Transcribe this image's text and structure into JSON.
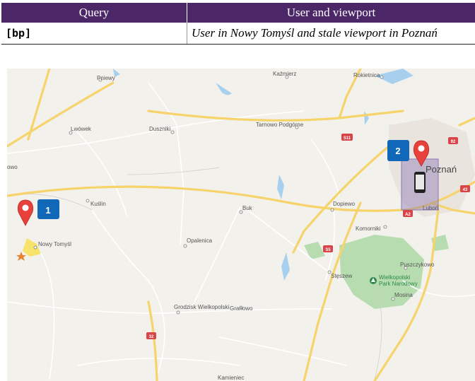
{
  "table": {
    "headers": [
      "Query",
      "User and viewport"
    ],
    "row": {
      "query": "[bp]",
      "description": "User in Nowy Tomyśl and stale viewport in Poznań"
    }
  },
  "map": {
    "places": [
      "Pniewy",
      "Kaźmierz",
      "Rokietnica",
      "Lwówek",
      "Duszniki",
      "Tarnowo Podgórne",
      "Kuślin",
      "Buk",
      "Dopiewo",
      "Nowy Tomyśl",
      "Opalenica",
      "Komorniki",
      "Stęszew",
      "Puszczykowo",
      "Mosina",
      "Grodzisk Wielkopolski",
      "Granowo",
      "Kamieniec",
      "Luboń",
      "Poznań"
    ],
    "edge_label": "owo",
    "park": [
      "Wielkopolski",
      "Park Narodowy"
    ],
    "markers": [
      "1",
      "2"
    ],
    "road_shields": [
      "S11",
      "92",
      "43",
      "A2",
      "S5",
      "32"
    ],
    "icons": [
      "map-pin-icon",
      "phone-icon",
      "star-icon",
      "park-icon"
    ],
    "colors": {
      "marker_badge": "#1167b8",
      "pin": "#e8413c",
      "viewport": "#8b78b5",
      "header_bg": "#4b2768"
    }
  }
}
